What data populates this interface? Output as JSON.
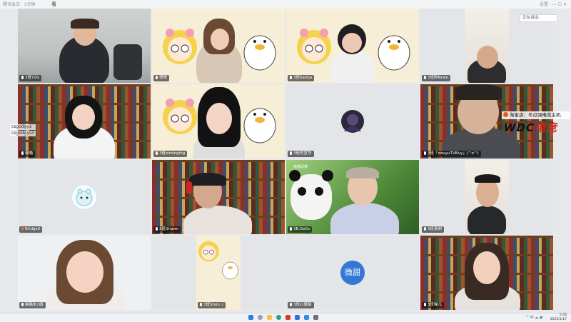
{
  "titlebar": {
    "app_name": "腾讯会议 · 1分钟",
    "meeting_id": "看",
    "right_text": "设置  ·  —  ☐  ✕"
  },
  "side_panel": {
    "chip": "正在讲话:"
  },
  "tiles": [
    {
      "label": "3班YZG"
    },
    {
      "label": "慢慢"
    },
    {
      "label": "3班Kamja"
    },
    {
      "label": "3班阿Nrain"
    },
    {
      "label": "喵喵"
    },
    {
      "label": "3班ximinging"
    },
    {
      "label": "3班的宫华"
    },
    {
      "label": "3班「douyuTVBuy」(^o^)"
    },
    {
      "label": "Bridge2"
    },
    {
      "label": "3班Shawn"
    },
    {
      "label": "3B.Gello"
    },
    {
      "label": "3班谢谢"
    },
    {
      "label": "猫猫米2组"
    },
    {
      "label": "3班Shon、)"
    },
    {
      "label": "3班心微甜"
    },
    {
      "label": "3班喵儿"
    }
  ],
  "overlay": {
    "names": [
      "csgodgys",
      "csgodgys3"
    ],
    "promo": "淘宝店：冬瓜强电竞主机",
    "brand": "WDC",
    "brand_suffix": "电竞"
  },
  "avatar_text": "微甜",
  "panda_caption": "熊猫滤镜",
  "taskbar": {
    "time": "5:06",
    "date": "2025/1/17",
    "tray": "^ 中 ☁ 🔊"
  },
  "colors": {
    "accent": "#3478d6",
    "brand_red": "#d0261d"
  }
}
